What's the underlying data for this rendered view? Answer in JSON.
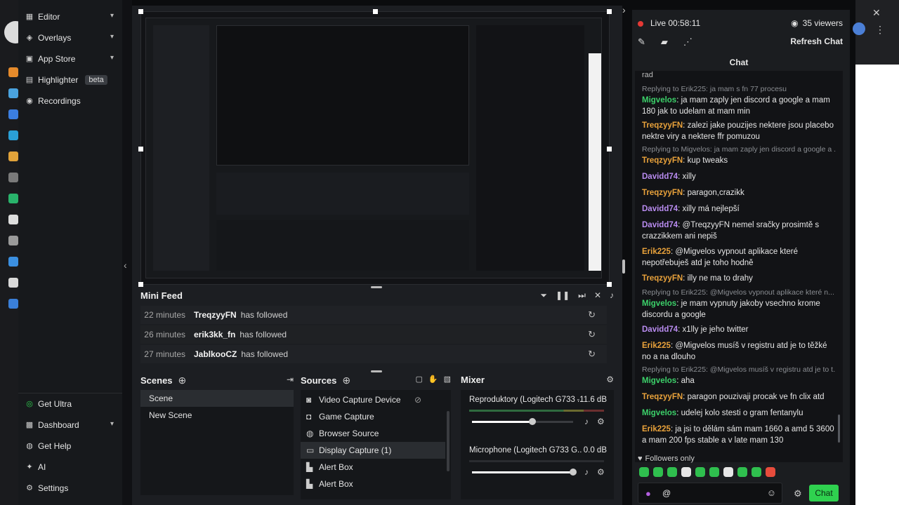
{
  "nav": {
    "items": [
      {
        "label": "Editor",
        "icon": "grid-icon",
        "chevron": true
      },
      {
        "label": "Overlays",
        "icon": "overlay-icon",
        "chevron": true
      },
      {
        "label": "App Store",
        "icon": "store-icon",
        "chevron": true
      },
      {
        "label": "Highlighter",
        "icon": "highlighter-icon",
        "badge": "beta"
      },
      {
        "label": "Recordings",
        "icon": "record-icon"
      }
    ],
    "bottom": [
      {
        "label": "Get Ultra",
        "icon": "ultra-icon"
      },
      {
        "label": "Dashboard",
        "icon": "dashboard-icon",
        "chevron": true
      },
      {
        "label": "Get Help",
        "icon": "help-icon"
      },
      {
        "label": "AI",
        "icon": "sparkle-icon"
      },
      {
        "label": "Settings",
        "icon": "gear-icon"
      }
    ]
  },
  "minifeed": {
    "title": "Mini Feed",
    "rows": [
      {
        "time": "22 minutes",
        "user": "TreqzyyFN",
        "action": "has followed"
      },
      {
        "time": "26 minutes",
        "user": "erik3kk_fn",
        "action": "has followed"
      },
      {
        "time": "27 minutes",
        "user": "JablkooCZ",
        "action": "has followed"
      }
    ]
  },
  "scenes": {
    "title": "Scenes",
    "items": [
      "Scene",
      "New Scene"
    ]
  },
  "sources": {
    "title": "Sources",
    "items": [
      {
        "label": "Video Capture Device",
        "icon": "camera-icon"
      },
      {
        "label": "Game Capture",
        "icon": "gamepad-icon"
      },
      {
        "label": "Browser Source",
        "icon": "globe-icon"
      },
      {
        "label": "Display Capture (1)",
        "icon": "monitor-icon"
      },
      {
        "label": "Alert Box",
        "icon": "alert-icon"
      },
      {
        "label": "Alert Box",
        "icon": "alert-icon"
      }
    ]
  },
  "mixer": {
    "title": "Mixer",
    "channels": [
      {
        "name": "Reproduktory (Logitech G733 ...",
        "level": "-11.6 dB",
        "volume": 0.6
      },
      {
        "name": "Microphone (Logitech G733 G...",
        "level": "0.0 dB",
        "volume": 1.0
      }
    ]
  },
  "live": {
    "status": "Live 00:58:11",
    "viewers": "35 viewers",
    "refresh_label": "Refresh Chat"
  },
  "chat": {
    "title": "Chat",
    "messages": [
      {
        "reply": "Replying to Erik225: ja mam s fn 77 procesu",
        "user": "Migvelos",
        "color": "#3cd16a",
        "text": "ja mam zaply jen discord a google a mam 180 jak to udelam at mam min"
      },
      {
        "user": "TreqzyyFN",
        "color": "#e9a23b",
        "text": "zalezi jake pouzijes nektere jsou placebo nektre viry a nektere ffr pomuzou"
      },
      {
        "reply": "Replying to Migvelos: ja mam zaply jen discord a google a ...",
        "user": "TreqzyyFN",
        "color": "#e9a23b",
        "text": "kup tweaks"
      },
      {
        "user": "Davidd74",
        "color": "#b98cf0",
        "text": "xilly"
      },
      {
        "user": "TreqzyyFN",
        "color": "#e9a23b",
        "text": "paragon,crazikk"
      },
      {
        "user": "Davidd74",
        "color": "#b98cf0",
        "text": "xilly má nejlepší"
      },
      {
        "user": "Davidd74",
        "color": "#b98cf0",
        "text": "@TreqzyyFN nemel sračky prosimtě s crazzikkem ani nepiš"
      },
      {
        "user": "Erik225",
        "color": "#e9a23b",
        "text": "@Migvelos vypnout aplikace které nepotřebuješ atd je toho hodně"
      },
      {
        "user": "TreqzyyFN",
        "color": "#e9a23b",
        "text": "illy ne ma to drahy"
      },
      {
        "reply": "Replying to Erik225: @Migvelos vypnout aplikace které n...",
        "user": "Migvelos",
        "color": "#3cd16a",
        "text": "je mam vypnuty jakoby vsechno krome discordu a google"
      },
      {
        "user": "Davidd74",
        "color": "#b98cf0",
        "text": "x1lly je jeho twitter"
      },
      {
        "user": "Erik225",
        "color": "#e9a23b",
        "text": "@Migvelos musíš v registru atd je to těžké no a na dlouho"
      },
      {
        "reply": "Replying to Erik225: @Migvelos musíš v registru atd je to t...",
        "user": "Migvelos",
        "color": "#3cd16a",
        "text": "aha"
      },
      {
        "user": "TreqzyyFN",
        "color": "#e9a23b",
        "text": "paragon pouzivaji procak ve fn clix atd"
      },
      {
        "user": "Migvelos",
        "color": "#3cd16a",
        "text": "udelej kolo stesti o gram fentanylu"
      },
      {
        "user": "Erik225",
        "color": "#e9a23b",
        "text": "ja jsi to dělám sám mam 1660 a amd 5 3600 a mam 200 fps stable a v late mam 130"
      }
    ],
    "followers_only": "Followers only",
    "input_value": "@",
    "send_label": "Chat"
  },
  "colors": {
    "accent": "#2fd14f",
    "live": "#e53935"
  }
}
